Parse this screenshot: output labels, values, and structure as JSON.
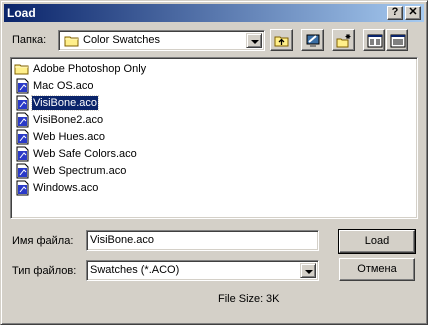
{
  "window": {
    "title": "Load"
  },
  "titlebar": {
    "help_glyph": "?",
    "close_glyph": "✕"
  },
  "lookin": {
    "label": "Папка:",
    "value": "Color Swatches",
    "icon": "folder-icon"
  },
  "toolbar": {
    "buttons": [
      "up-folder-icon",
      "desktop-icon",
      "new-folder-icon",
      "list-view-icon",
      "details-view-icon"
    ]
  },
  "files": [
    {
      "name": "Adobe Photoshop Only",
      "type": "folder",
      "icon": "folder-icon"
    },
    {
      "name": "Mac OS.aco",
      "type": "file",
      "icon": "swatch-file-icon"
    },
    {
      "name": "VisiBone.aco",
      "type": "file",
      "icon": "swatch-file-icon",
      "selected": true
    },
    {
      "name": "VisiBone2.aco",
      "type": "file",
      "icon": "swatch-file-icon"
    },
    {
      "name": "Web Hues.aco",
      "type": "file",
      "icon": "swatch-file-icon"
    },
    {
      "name": "Web Safe Colors.aco",
      "type": "file",
      "icon": "swatch-file-icon"
    },
    {
      "name": "Web Spectrum.aco",
      "type": "file",
      "icon": "swatch-file-icon"
    },
    {
      "name": "Windows.aco",
      "type": "file",
      "icon": "swatch-file-icon"
    }
  ],
  "filename": {
    "label": "Имя файла:",
    "value": "VisiBone.aco"
  },
  "filetype": {
    "label": "Тип файлов:",
    "value": "Swatches (*.ACO)"
  },
  "buttons": {
    "load": "Load",
    "cancel": "Отмена"
  },
  "fileinfo": {
    "label": "File Size:",
    "value": "3K"
  },
  "colors": {
    "title_active": "#0a246a",
    "title_gradient_end": "#a6caf0",
    "face": "#d4d0c8",
    "selection": "#0a246a"
  }
}
